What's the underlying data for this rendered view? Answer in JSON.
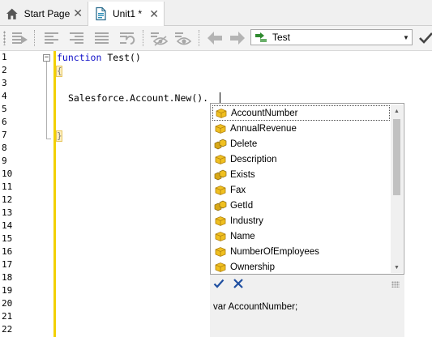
{
  "tabs": [
    {
      "label": "Start Page",
      "icon": "home-icon"
    },
    {
      "label": "Unit1 *",
      "icon": "unit-file-icon"
    }
  ],
  "toolbar": {
    "icons": [
      "run-icon",
      "align-left-icon",
      "align-right-icon",
      "justify-icon",
      "undo-indent-icon",
      "toggle-visibility-icon",
      "visibility-icon",
      "back-arrow-icon",
      "forward-arrow-icon"
    ],
    "routine_combo": {
      "value": "Test",
      "icon": "routine-icon"
    }
  },
  "editor": {
    "line_numbers": [
      "1",
      "2",
      "3",
      "4",
      "5",
      "6",
      "7",
      "8",
      "9",
      "10",
      "11",
      "12",
      "13",
      "14",
      "15",
      "16",
      "17",
      "18",
      "19",
      "20",
      "21",
      "22"
    ],
    "code": {
      "keyword": "function",
      "signature": " Test()",
      "open_brace": "{",
      "statement": "Salesforce.Account.New().",
      "close_brace": "}"
    }
  },
  "completion": {
    "items": [
      {
        "label": "AccountNumber",
        "kind": "property"
      },
      {
        "label": "AnnualRevenue",
        "kind": "property"
      },
      {
        "label": "Delete",
        "kind": "method"
      },
      {
        "label": "Description",
        "kind": "property"
      },
      {
        "label": "Exists",
        "kind": "method"
      },
      {
        "label": "Fax",
        "kind": "property"
      },
      {
        "label": "GetId",
        "kind": "method"
      },
      {
        "label": "Industry",
        "kind": "property"
      },
      {
        "label": "Name",
        "kind": "property"
      },
      {
        "label": "NumberOfEmployees",
        "kind": "property"
      },
      {
        "label": "Ownership",
        "kind": "property"
      }
    ],
    "selected_index": 0,
    "description": "var AccountNumber;"
  },
  "colors": {
    "keyword": "#1010c8",
    "change_bar": "#f2d000",
    "property_icon": "#f0c020",
    "method_icon": "#d8a818"
  }
}
